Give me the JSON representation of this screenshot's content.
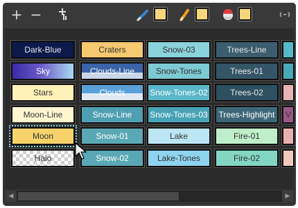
{
  "toolbar": {
    "add_label": "+",
    "remove_label": "−",
    "add_icon": "add-icon",
    "remove_icon": "remove-icon",
    "merge_icon": "merge-plus-icon",
    "brush_icon": "brush-icon",
    "pencil_icon": "pencil-icon",
    "paint_icon": "paint-bucket-icon",
    "link_icon": "link-icon",
    "swatch_color": "#f4d77a"
  },
  "palette": {
    "rows": [
      {
        "cells": [
          {
            "label": "Dark-Blue",
            "color": "#0b1a4a",
            "text": "#e8e8e8"
          },
          {
            "label": "Craters",
            "color": "#f5c970",
            "text": "#333333"
          },
          {
            "label": "Snow-03",
            "color": "#8ad2dc",
            "text": "#333333"
          },
          {
            "label": "Trees-Line",
            "color": "#3b5d6e",
            "text": "#e8e8e8"
          },
          {
            "label": "",
            "color": "#57b9c7",
            "text": "#333333"
          }
        ]
      },
      {
        "cells": [
          {
            "label": "Sky",
            "color": "#6b58c8",
            "text": "#ffffff"
          },
          {
            "label": "Clouds-Line",
            "color": "#3a63a8",
            "text": "#ffffff"
          },
          {
            "label": "Snow-Tones",
            "color": "#7ccad3",
            "text": "#333333"
          },
          {
            "label": "Trees-01",
            "color": "#335566",
            "text": "#e8e8e8"
          },
          {
            "label": "",
            "color": "#4aa9b8",
            "text": "#333333"
          }
        ]
      },
      {
        "cells": [
          {
            "label": "Stars",
            "color": "#fff2b8",
            "text": "#333333"
          },
          {
            "label": "Clouds",
            "color": "#5aa0d8",
            "text": "#ffffff"
          },
          {
            "label": "Snow-Tones-02",
            "color": "#5ab6c8",
            "text": "#ffffff"
          },
          {
            "label": "Trees-02",
            "color": "#2e5060",
            "text": "#e8e8e8"
          },
          {
            "label": "",
            "color": "#e7b3b6",
            "text": "#333333"
          }
        ]
      },
      {
        "cells": [
          {
            "label": "Moon-Line",
            "color": "#fff6cf",
            "text": "#333333"
          },
          {
            "label": "Snow-Line",
            "color": "#4e9fb2",
            "text": "#ffffff"
          },
          {
            "label": "Snow-Tones-03",
            "color": "#48a3b6",
            "text": "#ffffff"
          },
          {
            "label": "Trees-Highlight",
            "color": "#3e6878",
            "text": "#ffffff"
          },
          {
            "label": "V",
            "color": "#9a5a86",
            "text": "#333333"
          }
        ]
      },
      {
        "cells": [
          {
            "label": "Moon",
            "color": "#f5d36a",
            "text": "#333333",
            "selected": true
          },
          {
            "label": "Snow-01",
            "color": "#5aa8b5",
            "text": "#ffffff"
          },
          {
            "label": "Lake",
            "color": "#bde6f5",
            "text": "#333333"
          },
          {
            "label": "Fire-01",
            "color": "#bfeecb",
            "text": "#333333"
          },
          {
            "label": "",
            "color": "#e8b1b0",
            "text": "#333333"
          }
        ]
      },
      {
        "cells": [
          {
            "label": "Halo",
            "color": "#ffffff",
            "text": "#333333"
          },
          {
            "label": "Snow-02",
            "color": "#5aa8b5",
            "text": "#ffffff"
          },
          {
            "label": "Lake-Tones",
            "color": "#8fd4ee",
            "text": "#333333"
          },
          {
            "label": "Fire-02",
            "color": "#83d6c1",
            "text": "#333333"
          },
          {
            "label": "",
            "color": "#f4c9bd",
            "text": "#333333"
          }
        ]
      }
    ]
  },
  "scrollbar": {
    "left_arrow": "◀",
    "right_arrow": "▶"
  }
}
